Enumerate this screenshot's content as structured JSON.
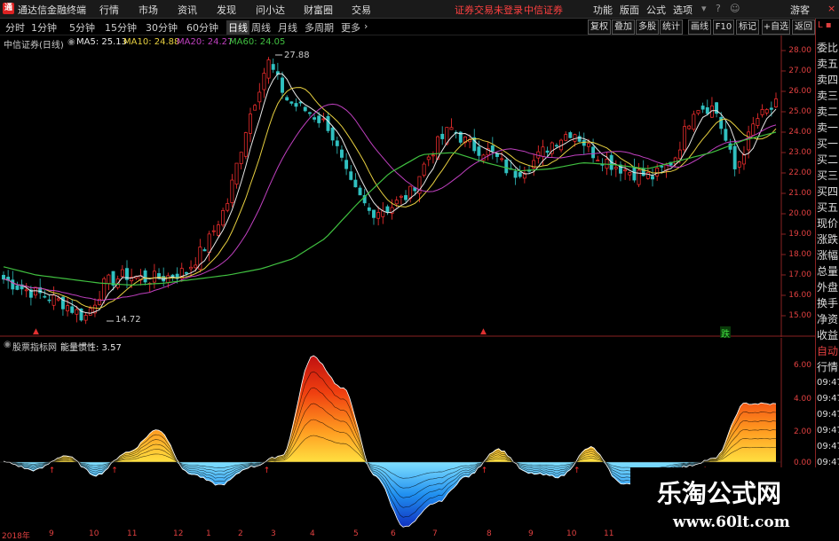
{
  "app": {
    "title": "通达信金融终端"
  },
  "topmenu": [
    "行情",
    "市场",
    "资讯",
    "发现",
    "问小达",
    "财富圈",
    "交易"
  ],
  "login_status": "证券交易未登录",
  "broker": "中信证券",
  "top_right": [
    "功能",
    "版面",
    "公式",
    "选项",
    "游客"
  ],
  "periods": [
    "分时",
    "1分钟",
    "5分钟",
    "15分钟",
    "30分钟",
    "60分钟",
    "日线",
    "周线",
    "月线",
    "多周期",
    "更多"
  ],
  "active_period": "日线",
  "toolbar_right": [
    "复权",
    "叠加",
    "多股",
    "统计",
    "画线",
    "F10",
    "标记",
    "+自选",
    "返回"
  ],
  "main_legend": {
    "stock": "中信证券(日线)",
    "ma5": "MA5: 25.13",
    "ma10": "MA10: 24.88",
    "ma20": "MA20: 24.27",
    "ma60": "MA60: 24.05"
  },
  "price_axis": [
    "28.00",
    "27.00",
    "26.00",
    "25.00",
    "24.00",
    "23.00",
    "22.00",
    "21.00",
    "20.00",
    "19.00",
    "18.00",
    "17.00",
    "16.00",
    "15.00"
  ],
  "price_annotations": {
    "high": "27.88",
    "low": "14.72"
  },
  "marker_label": "跌",
  "indicator_legend": {
    "name": "股票指标网",
    "value_label": "能量惯性: 3.57"
  },
  "indicator_axis": [
    "6.00",
    "4.00",
    "2.00",
    "0.00"
  ],
  "dates": [
    "2018年",
    "9",
    "10",
    "11",
    "12",
    "1",
    "2",
    "3",
    "4",
    "5",
    "6",
    "7",
    "8",
    "9",
    "10",
    "11"
  ],
  "right_panel": [
    "委比",
    "卖五",
    "卖四",
    "卖三",
    "卖二",
    "卖一",
    "买一",
    "买二",
    "买三",
    "买四",
    "买五",
    "现价",
    "涨跌",
    "涨幅",
    "总量",
    "外盘",
    "换手",
    "净资",
    "收益"
  ],
  "right_panel_lower": [
    "自动",
    "行情",
    "09:47",
    "09:47",
    "09:47",
    "09:47",
    "09:47",
    "09:47"
  ],
  "watermark": {
    "title": "乐淘公式网",
    "url": "www.60lt.com"
  },
  "colors": {
    "ma5": "#e8e8e8",
    "ma10": "#e8d040",
    "ma20": "#c040c0",
    "ma60": "#40c040",
    "up": "#ff3030",
    "down": "#30c0c0",
    "axis": "#8a2222"
  },
  "chart_data": {
    "type": "line",
    "title": "中信证券(日线)",
    "series": [
      {
        "name": "MA60",
        "values": [
          17.4,
          17.0,
          16.8,
          16.6,
          16.5,
          16.6,
          16.8,
          17.0,
          17.3,
          17.8,
          18.8,
          20.5,
          22.0,
          22.9,
          23.0,
          22.5,
          22.1,
          22.2,
          22.5,
          22.4,
          22.2,
          22.6,
          23.0,
          23.6,
          24.0
        ]
      }
    ],
    "ylim": [
      14.5,
      28.5
    ],
    "indicator": {
      "name": "能量惯性",
      "values": [
        0.0,
        -0.5,
        0.4,
        -0.8,
        0.6,
        2.0,
        -0.7,
        -1.4,
        -0.3,
        0.4,
        6.5,
        4.5,
        -0.8,
        -4.0,
        -2.5,
        -0.9,
        0.8,
        -0.7,
        -0.9,
        0.9,
        -1.3,
        -1.6,
        -0.3,
        0.2,
        3.6,
        3.57
      ],
      "ylim": [
        -4.5,
        7.5
      ]
    }
  }
}
